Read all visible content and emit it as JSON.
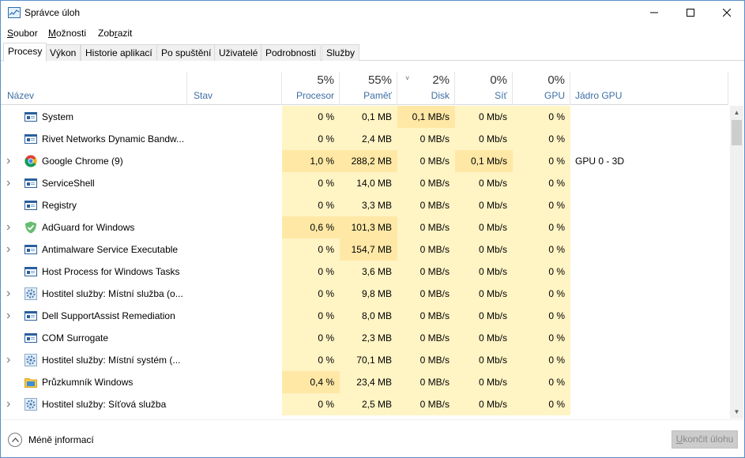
{
  "window": {
    "title": "Správce úloh",
    "minimize_glyph": "—",
    "maximize_glyph": "☐",
    "close_glyph": "✕"
  },
  "menu": [
    {
      "label": "Soubor",
      "underline": "S",
      "rest": "oubor"
    },
    {
      "label": "Možnosti",
      "underline": "M",
      "rest": "ožnosti"
    },
    {
      "label": "Zobrazit",
      "pre": "Zob",
      "underline": "r",
      "rest": "azit"
    }
  ],
  "tabs": [
    {
      "label": "Procesy",
      "active": true
    },
    {
      "label": "Výkon"
    },
    {
      "label": "Historie aplikací"
    },
    {
      "label": "Po spuštění"
    },
    {
      "label": "Uživatelé"
    },
    {
      "label": "Podrobnosti"
    },
    {
      "label": "Služby"
    }
  ],
  "columns": {
    "name": {
      "label": "Název"
    },
    "status": {
      "label": "Stav"
    },
    "cpu": {
      "label": "Procesor",
      "pct": "5%"
    },
    "memory": {
      "label": "Paměť",
      "pct": "55%"
    },
    "disk": {
      "label": "Disk",
      "pct": "2%",
      "sort_indicator": "˅"
    },
    "network": {
      "label": "Síť",
      "pct": "0%"
    },
    "gpu": {
      "label": "GPU",
      "pct": "0%"
    },
    "gpu_engine": {
      "label": "Jádro GPU"
    }
  },
  "processes": [
    {
      "name": "System",
      "expandable": false,
      "icon": "app-window-icon",
      "cpu": "0 %",
      "memory": "0,1 MB",
      "disk": "0,1 MB/s",
      "network": "0 Mb/s",
      "gpu": "0 %",
      "gpu_engine": ""
    },
    {
      "name": "Rivet Networks Dynamic Bandw...",
      "expandable": false,
      "icon": "app-window-icon",
      "cpu": "0 %",
      "memory": "2,4 MB",
      "disk": "0 MB/s",
      "network": "0 Mb/s",
      "gpu": "0 %",
      "gpu_engine": ""
    },
    {
      "name": "Google Chrome (9)",
      "expandable": true,
      "icon": "chrome-icon",
      "cpu": "1,0 %",
      "memory": "288,2 MB",
      "disk": "0 MB/s",
      "network": "0,1 Mb/s",
      "gpu": "0 %",
      "gpu_engine": "GPU 0 - 3D"
    },
    {
      "name": "ServiceShell",
      "expandable": true,
      "icon": "app-window-icon",
      "cpu": "0 %",
      "memory": "14,0 MB",
      "disk": "0 MB/s",
      "network": "0 Mb/s",
      "gpu": "0 %",
      "gpu_engine": ""
    },
    {
      "name": "Registry",
      "expandable": false,
      "icon": "app-window-icon",
      "cpu": "0 %",
      "memory": "3,3 MB",
      "disk": "0 MB/s",
      "network": "0 Mb/s",
      "gpu": "0 %",
      "gpu_engine": ""
    },
    {
      "name": "AdGuard for Windows",
      "expandable": true,
      "icon": "adguard-shield-icon",
      "cpu": "0,6 %",
      "memory": "101,3 MB",
      "disk": "0 MB/s",
      "network": "0 Mb/s",
      "gpu": "0 %",
      "gpu_engine": ""
    },
    {
      "name": "Antimalware Service Executable",
      "expandable": true,
      "icon": "app-window-icon",
      "cpu": "0 %",
      "memory": "154,7 MB",
      "disk": "0 MB/s",
      "network": "0 Mb/s",
      "gpu": "0 %",
      "gpu_engine": ""
    },
    {
      "name": "Host Process for Windows Tasks",
      "expandable": false,
      "icon": "app-window-icon",
      "cpu": "0 %",
      "memory": "3,6 MB",
      "disk": "0 MB/s",
      "network": "0 Mb/s",
      "gpu": "0 %",
      "gpu_engine": ""
    },
    {
      "name": "Hostitel služby: Místní služba (o...",
      "expandable": true,
      "icon": "gear-icon",
      "cpu": "0 %",
      "memory": "9,8 MB",
      "disk": "0 MB/s",
      "network": "0 Mb/s",
      "gpu": "0 %",
      "gpu_engine": ""
    },
    {
      "name": "Dell SupportAssist Remediation",
      "expandable": true,
      "icon": "app-window-icon",
      "cpu": "0 %",
      "memory": "8,0 MB",
      "disk": "0 MB/s",
      "network": "0 Mb/s",
      "gpu": "0 %",
      "gpu_engine": ""
    },
    {
      "name": "COM Surrogate",
      "expandable": false,
      "icon": "app-window-icon",
      "cpu": "0 %",
      "memory": "2,3 MB",
      "disk": "0 MB/s",
      "network": "0 Mb/s",
      "gpu": "0 %",
      "gpu_engine": ""
    },
    {
      "name": "Hostitel služby: Místní systém (...",
      "expandable": true,
      "icon": "gear-icon",
      "cpu": "0 %",
      "memory": "70,1 MB",
      "disk": "0 MB/s",
      "network": "0 Mb/s",
      "gpu": "0 %",
      "gpu_engine": ""
    },
    {
      "name": "Průzkumník Windows",
      "expandable": false,
      "icon": "folder-icon",
      "cpu": "0,4 %",
      "memory": "23,4 MB",
      "disk": "0 MB/s",
      "network": "0 Mb/s",
      "gpu": "0 %",
      "gpu_engine": ""
    },
    {
      "name": "Hostitel služby: Síťová služba",
      "expandable": true,
      "icon": "gear-icon",
      "cpu": "0 %",
      "memory": "2,5 MB",
      "disk": "0 MB/s",
      "network": "0 Mb/s",
      "gpu": "0 %",
      "gpu_engine": ""
    }
  ],
  "footer": {
    "less_info": {
      "pre": "Méně ",
      "underline": "i",
      "rest": "nformací"
    },
    "end_task": {
      "underline": "U",
      "rest": "končit úlohu"
    }
  },
  "colors": {
    "heat_light": "#fff4c4",
    "heat_medium": "#ffe8a6",
    "header_label": "#3d6ea3",
    "window_border": "#5a8ec7"
  }
}
